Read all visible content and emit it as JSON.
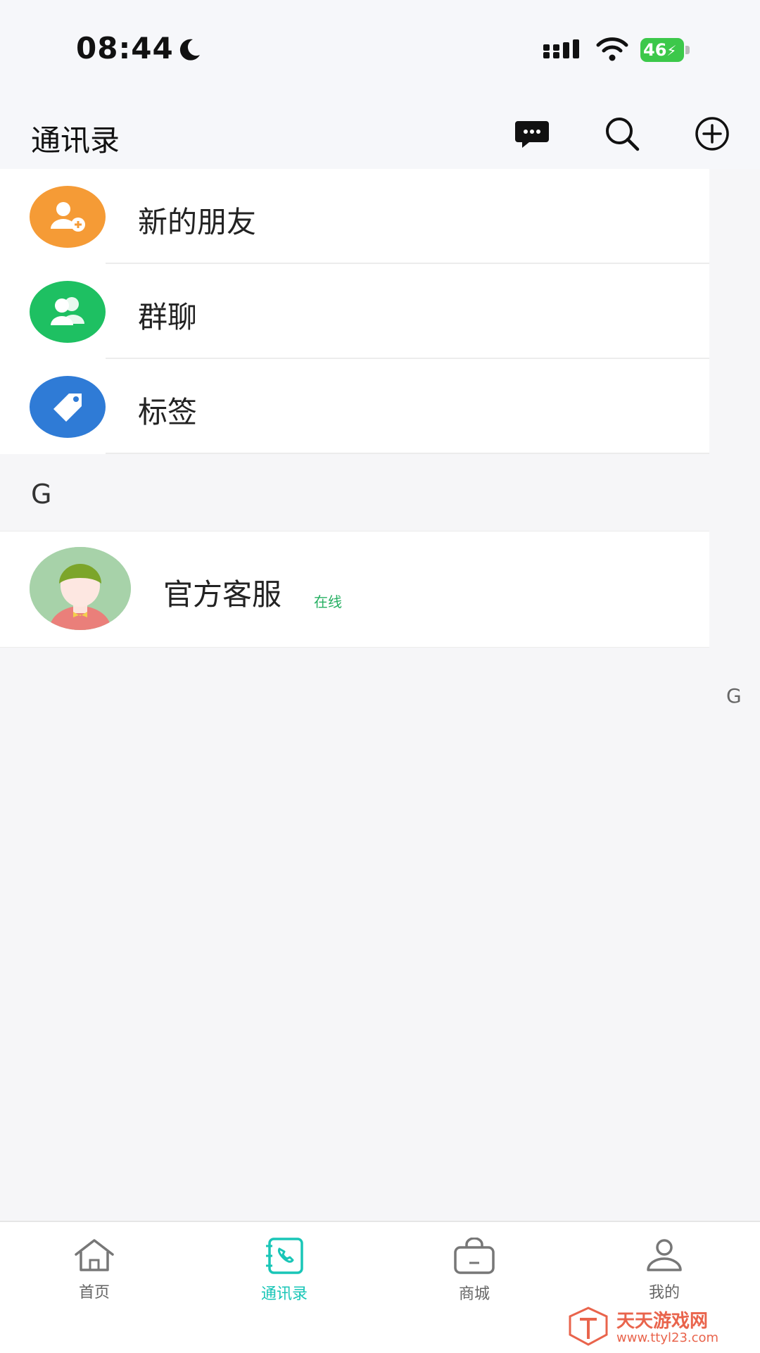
{
  "status_bar": {
    "time": "08:44",
    "battery": "46"
  },
  "header": {
    "title": "通讯录",
    "icons": [
      "message-icon",
      "search-icon",
      "add-circle-icon"
    ]
  },
  "menu": [
    {
      "label": "新的朋友",
      "icon": "add-friend-icon",
      "color": "#f59b36"
    },
    {
      "label": "群聊",
      "icon": "group-icon",
      "color": "#1ec062"
    },
    {
      "label": "标签",
      "icon": "tag-icon",
      "color": "#2f7bd6"
    }
  ],
  "section": {
    "letter": "G"
  },
  "contacts": [
    {
      "name": "官方客服",
      "status": "在线"
    }
  ],
  "index_bar": {
    "letter": "G"
  },
  "tabbar": {
    "tabs": [
      {
        "label": "首页",
        "icon": "home-icon"
      },
      {
        "label": "通讯录",
        "icon": "contacts-icon",
        "active": true
      },
      {
        "label": "商城",
        "icon": "shop-icon"
      },
      {
        "label": "我的",
        "icon": "profile-icon"
      }
    ]
  },
  "watermark": {
    "text": "天天游戏网",
    "url": "www.ttyl23.com"
  },
  "colors": {
    "accent": "#19c6b7",
    "online": "#27b063"
  }
}
